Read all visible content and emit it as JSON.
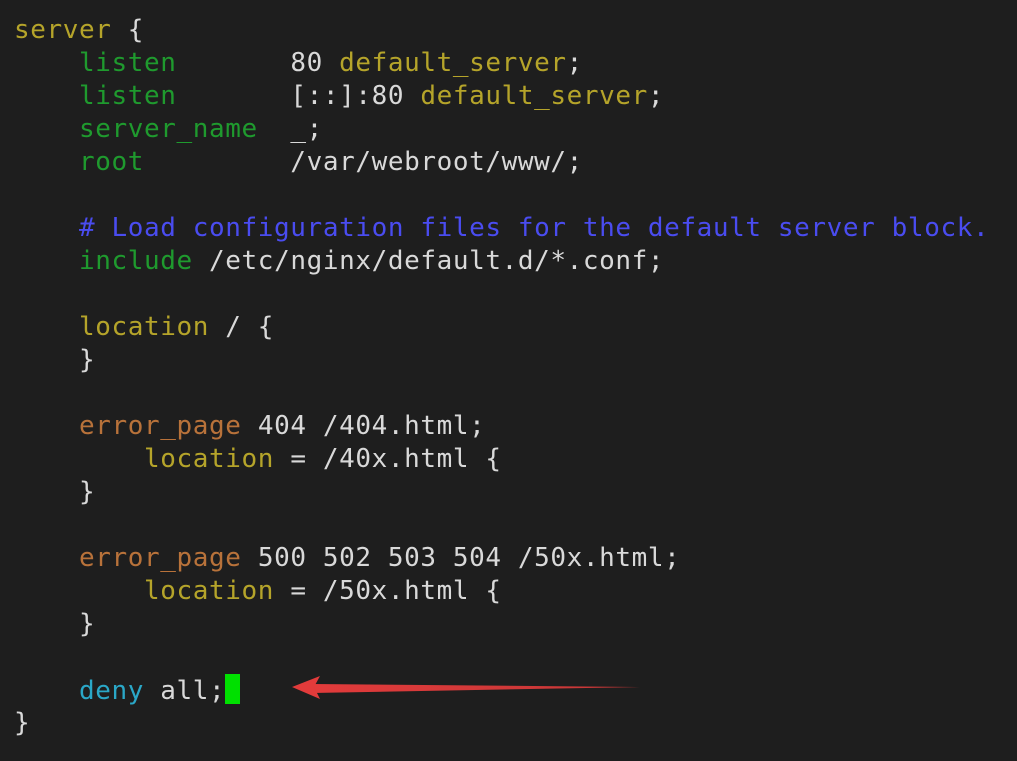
{
  "editor": {
    "lines": [
      {
        "i": "",
        "tokens": [
          {
            "t": "server",
            "c": "t-block"
          },
          {
            "t": " {",
            "c": "t-default"
          }
        ]
      },
      {
        "i": "    ",
        "tokens": [
          {
            "t": "listen",
            "c": "t-dir"
          },
          {
            "t": "       80 ",
            "c": "t-val"
          },
          {
            "t": "default_server",
            "c": "t-kw"
          },
          {
            "t": ";",
            "c": "t-val"
          }
        ]
      },
      {
        "i": "    ",
        "tokens": [
          {
            "t": "listen",
            "c": "t-dir"
          },
          {
            "t": "       [::]:80 ",
            "c": "t-val"
          },
          {
            "t": "default_server",
            "c": "t-kw"
          },
          {
            "t": ";",
            "c": "t-val"
          }
        ]
      },
      {
        "i": "    ",
        "tokens": [
          {
            "t": "server_name",
            "c": "t-dir"
          },
          {
            "t": "  _;",
            "c": "t-val"
          }
        ]
      },
      {
        "i": "    ",
        "tokens": [
          {
            "t": "root",
            "c": "t-dir"
          },
          {
            "t": "         /var/webroot/www/;",
            "c": "t-val"
          }
        ]
      },
      {
        "i": "",
        "tokens": []
      },
      {
        "i": "    ",
        "tokens": [
          {
            "t": "# Load configuration files for the default server block.",
            "c": "t-comment"
          }
        ]
      },
      {
        "i": "    ",
        "tokens": [
          {
            "t": "include",
            "c": "t-dir"
          },
          {
            "t": " /etc/nginx/default.d/*.conf;",
            "c": "t-val"
          }
        ]
      },
      {
        "i": "",
        "tokens": []
      },
      {
        "i": "    ",
        "tokens": [
          {
            "t": "location",
            "c": "t-kw"
          },
          {
            "t": " / {",
            "c": "t-val"
          }
        ]
      },
      {
        "i": "    ",
        "tokens": [
          {
            "t": "}",
            "c": "t-val"
          }
        ]
      },
      {
        "i": "",
        "tokens": []
      },
      {
        "i": "    ",
        "tokens": [
          {
            "t": "error_page",
            "c": "t-err"
          },
          {
            "t": " 404 /404.html;",
            "c": "t-val"
          }
        ]
      },
      {
        "i": "        ",
        "tokens": [
          {
            "t": "location",
            "c": "t-kw"
          },
          {
            "t": " = /40x.html {",
            "c": "t-val"
          }
        ]
      },
      {
        "i": "    ",
        "tokens": [
          {
            "t": "}",
            "c": "t-val"
          }
        ]
      },
      {
        "i": "",
        "tokens": []
      },
      {
        "i": "    ",
        "tokens": [
          {
            "t": "error_page",
            "c": "t-err"
          },
          {
            "t": " 500 502 503 504 /50x.html;",
            "c": "t-val"
          }
        ]
      },
      {
        "i": "        ",
        "tokens": [
          {
            "t": "location",
            "c": "t-kw"
          },
          {
            "t": " = /50x.html {",
            "c": "t-val"
          }
        ]
      },
      {
        "i": "    ",
        "tokens": [
          {
            "t": "}",
            "c": "t-val"
          }
        ]
      },
      {
        "i": "",
        "tokens": []
      },
      {
        "i": "    ",
        "tokens": [
          {
            "t": "deny",
            "c": "t-deny"
          },
          {
            "t": " all;",
            "c": "t-val"
          }
        ],
        "cursor": true
      },
      {
        "i": "",
        "tokens": [
          {
            "t": "}",
            "c": "t-default"
          }
        ]
      }
    ]
  },
  "annotation": {
    "name": "red-arrow",
    "color": "#e23b3b",
    "points_to": "deny all;"
  },
  "colors": {
    "background": "#1e1e1e",
    "block": "#b5a42a",
    "directive": "#1f9a2e",
    "value": "#d9d9d9",
    "comment": "#4a4cf0",
    "error_page": "#b8723a",
    "deny": "#2aa7c7",
    "cursor": "#00e000"
  }
}
